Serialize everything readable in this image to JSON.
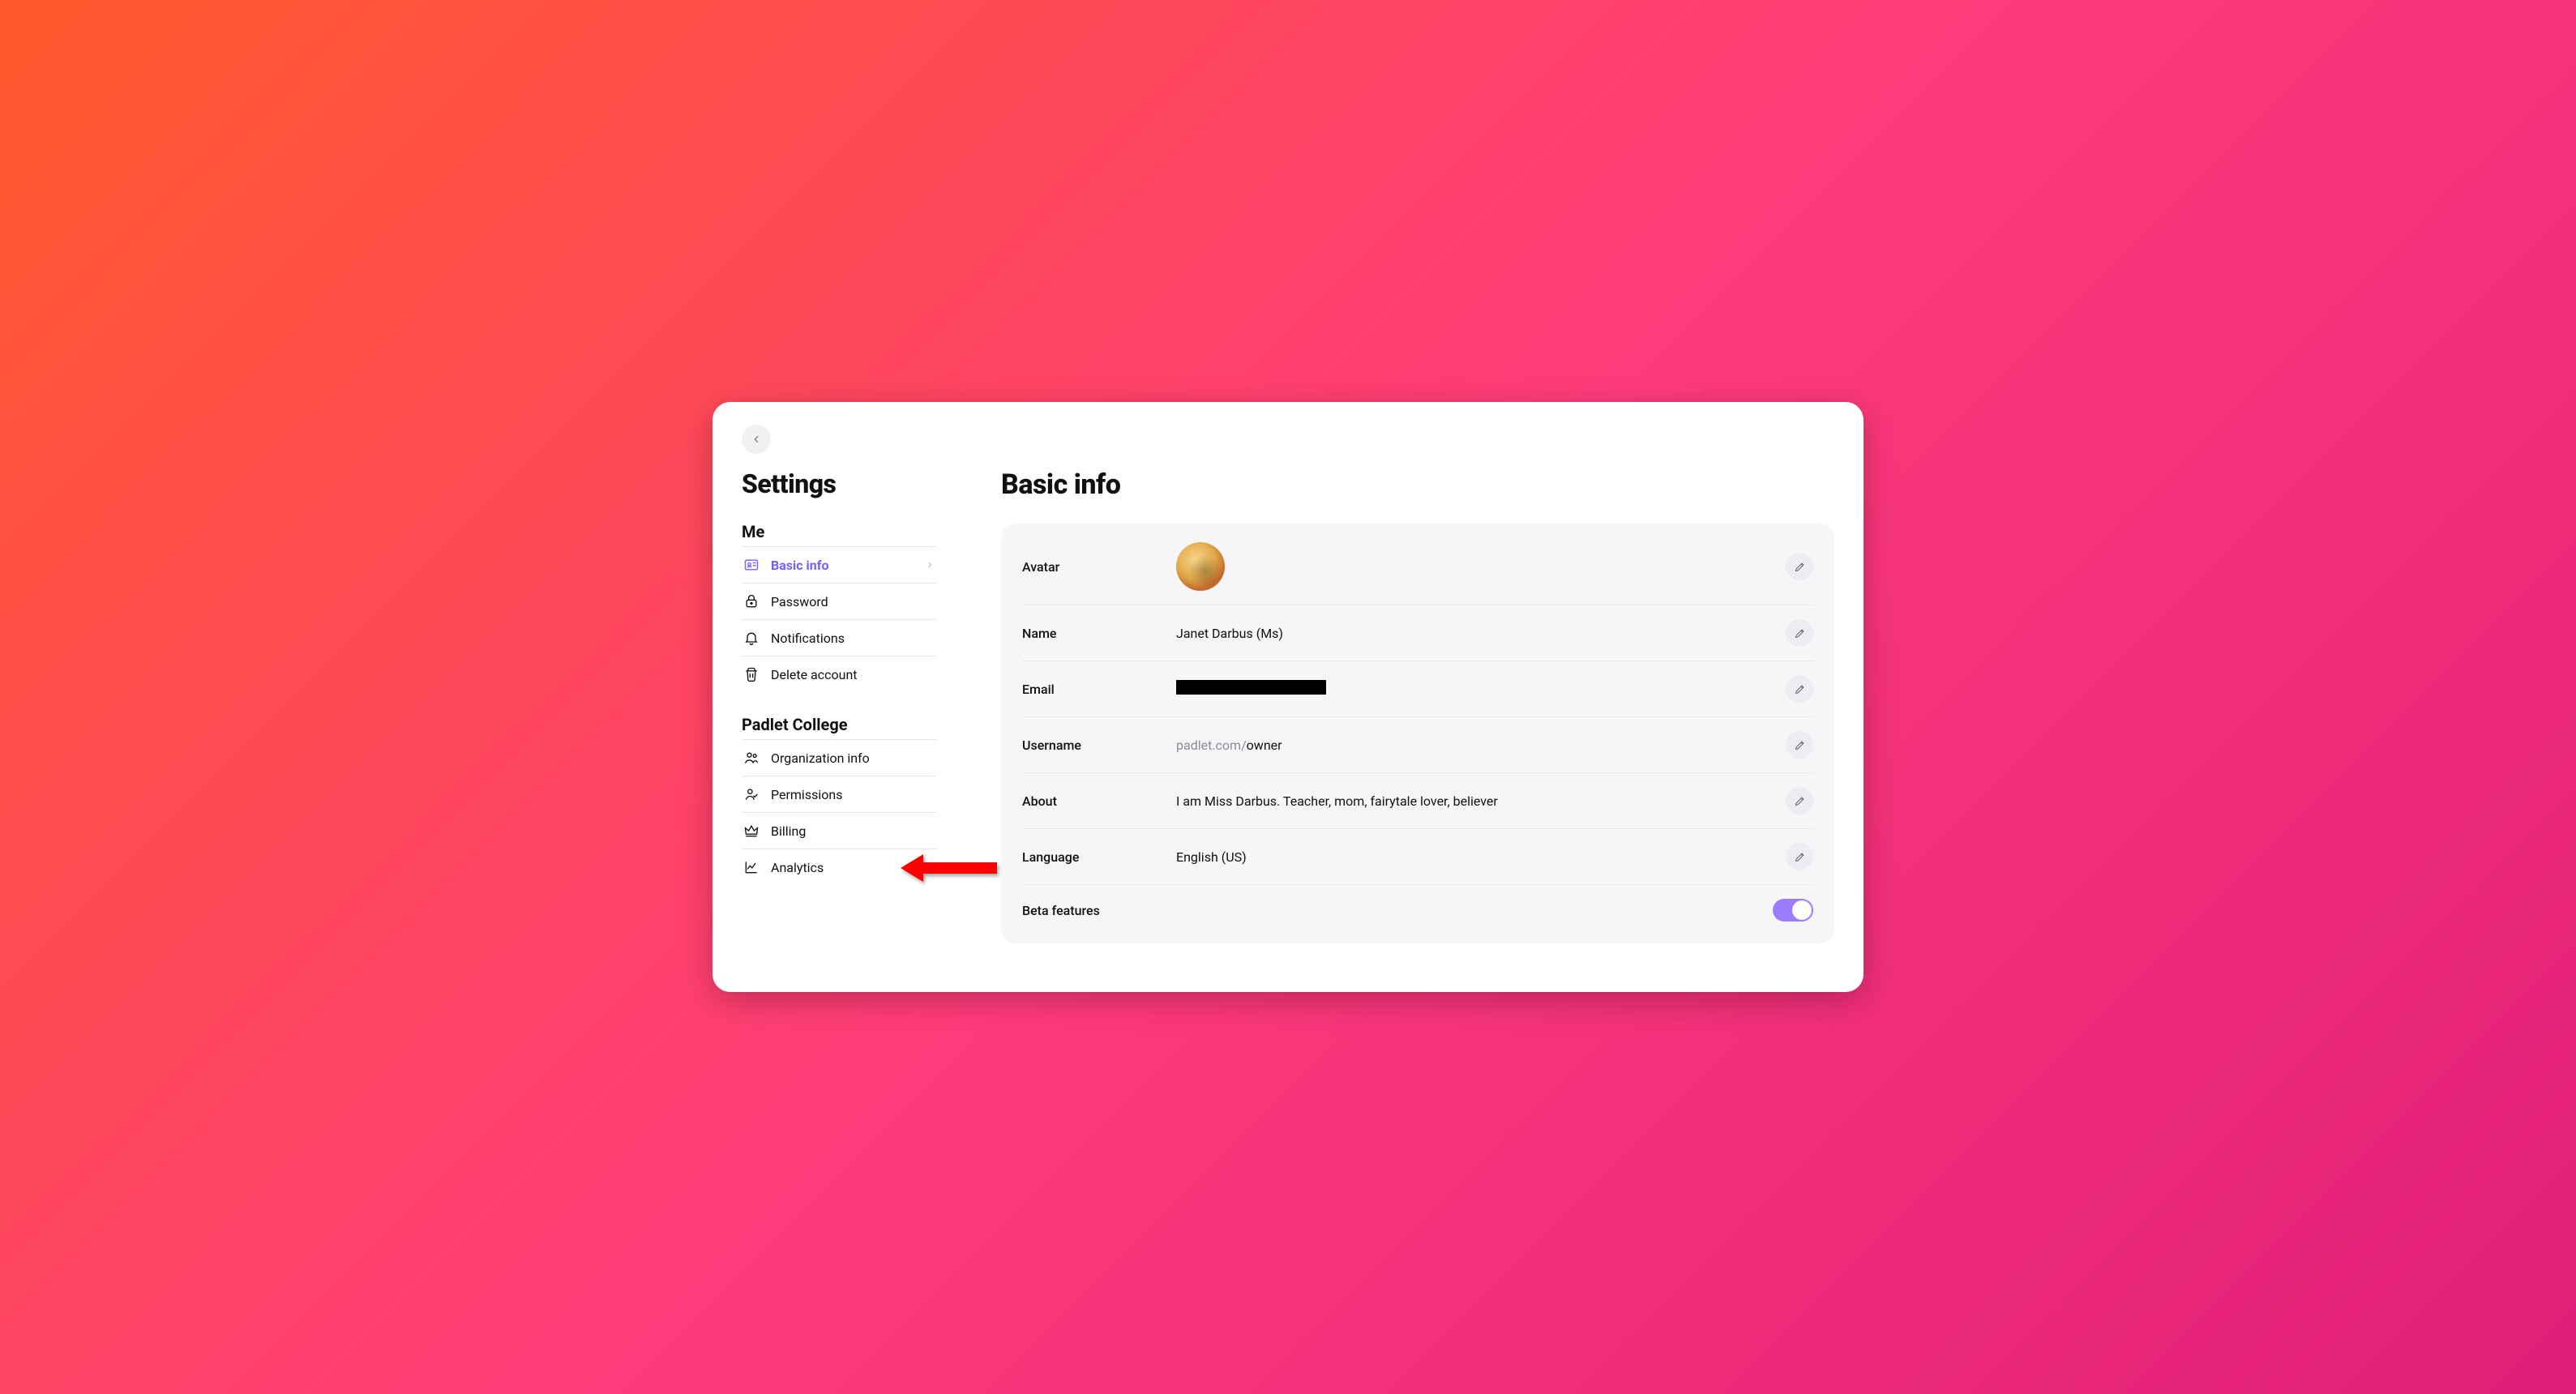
{
  "sidebar": {
    "title": "Settings",
    "sections": [
      {
        "label": "Me",
        "items": [
          {
            "label": "Basic info"
          },
          {
            "label": "Password"
          },
          {
            "label": "Notifications"
          },
          {
            "label": "Delete account"
          }
        ]
      },
      {
        "label": "Padlet College",
        "items": [
          {
            "label": "Organization info"
          },
          {
            "label": "Permissions"
          },
          {
            "label": "Billing"
          },
          {
            "label": "Analytics"
          }
        ]
      }
    ]
  },
  "main": {
    "heading": "Basic info",
    "rows": {
      "avatar": {
        "label": "Avatar"
      },
      "name": {
        "label": "Name",
        "value": "Janet Darbus (Ms)"
      },
      "email": {
        "label": "Email",
        "value_redacted": true
      },
      "username": {
        "label": "Username",
        "prefix": "padlet.com/",
        "value": "owner"
      },
      "about": {
        "label": "About",
        "value": "I am Miss Darbus. Teacher, mom, fairytale lover, believer"
      },
      "language": {
        "label": "Language",
        "value": "English (US)"
      },
      "beta": {
        "label": "Beta features",
        "enabled": true
      }
    }
  },
  "colors": {
    "accent": "#7b5cff",
    "toggle_on": "#9b7bff"
  }
}
